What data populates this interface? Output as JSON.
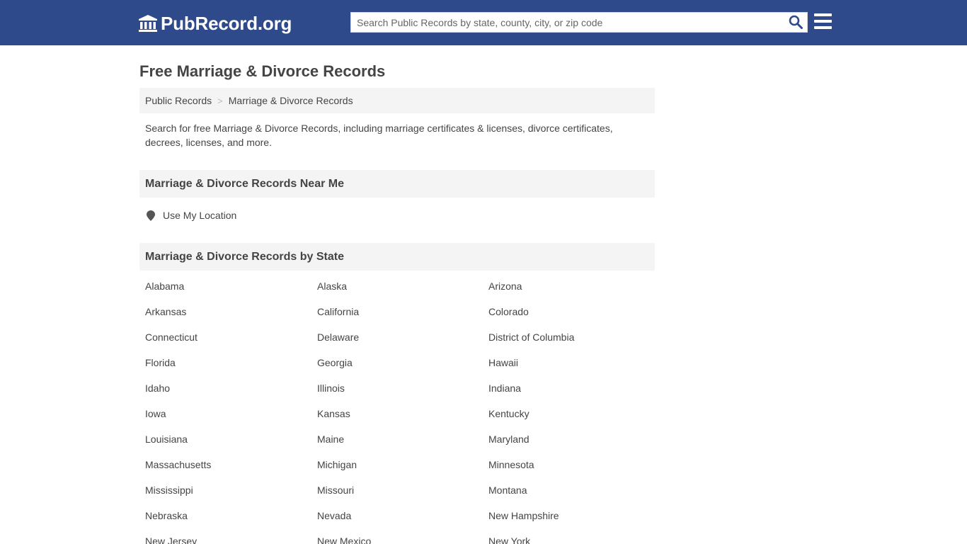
{
  "header": {
    "logo_text": "PubRecord.org",
    "search_placeholder": "Search Public Records by state, county, city, or zip code"
  },
  "page": {
    "title": "Free Marriage & Divorce Records",
    "breadcrumb": {
      "root": "Public Records",
      "separator": ">",
      "current": "Marriage & Divorce Records"
    },
    "intro": "Search for free Marriage & Divorce Records, including marriage certificates & licenses, divorce certificates, decrees, licenses, and more.",
    "near_me_heading": "Marriage & Divorce Records Near Me",
    "use_location_label": "Use My Location",
    "by_state_heading": "Marriage & Divorce Records by State",
    "states": [
      "Alabama",
      "Alaska",
      "Arizona",
      "Arkansas",
      "California",
      "Colorado",
      "Connecticut",
      "Delaware",
      "District of Columbia",
      "Florida",
      "Georgia",
      "Hawaii",
      "Idaho",
      "Illinois",
      "Indiana",
      "Iowa",
      "Kansas",
      "Kentucky",
      "Louisiana",
      "Maine",
      "Maryland",
      "Massachusetts",
      "Michigan",
      "Minnesota",
      "Mississippi",
      "Missouri",
      "Montana",
      "Nebraska",
      "Nevada",
      "New Hampshire",
      "New Jersey",
      "New Mexico",
      "New York"
    ]
  },
  "colors": {
    "header_bg": "#2f4a8a",
    "search_icon": "#2f4a8a",
    "panel_bg": "#f4f4f4",
    "text": "#444444"
  }
}
